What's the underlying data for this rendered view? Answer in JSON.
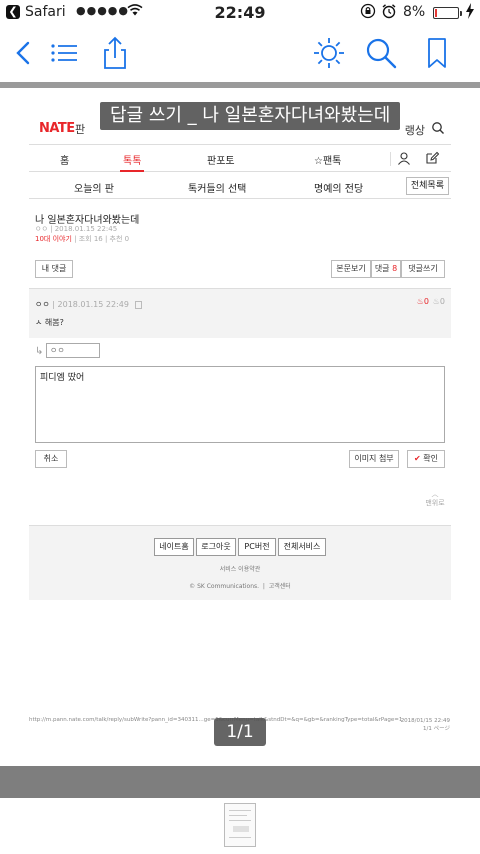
{
  "status_bar": {
    "back_app": "Safari",
    "signal": "●●●●●",
    "time": "22:49",
    "battery_pct": "8%",
    "battery_level": 0.08
  },
  "toolbar": {
    "back_icon": "chevron-left-icon",
    "list_icon": "list-icon",
    "share_icon": "share-icon",
    "brightness_icon": "brightness-icon",
    "search_icon": "search-icon",
    "bookmark_icon": "bookmark-icon",
    "accent": "#1a73e8"
  },
  "pdf_title": "답글 쓰기 _ 나 일본혼자다녀와봤는데",
  "site": {
    "logo": "NATE",
    "logo_suffix": "판",
    "header_right": "랭상"
  },
  "nav": {
    "tabs": [
      "홈",
      "톡톡",
      "판포토",
      "☆팬톡"
    ],
    "sub_tabs": [
      "오늘의 판",
      "톡커들의 선택",
      "명예의 전당"
    ],
    "list_button": "전체목록"
  },
  "post": {
    "title": "나 일본혼자다녀와봤는데",
    "author": "ㅇㅇ",
    "date": "2018.01.15 22:45",
    "category": "10대 이야기",
    "views": "조회 16",
    "recommends": "추천 0"
  },
  "actions": {
    "my_comments": "내 댓글",
    "view_original": "본문보기",
    "comments_label": "댓글",
    "comments_count": "8",
    "write_comment": "댓글쓰기"
  },
  "comment": {
    "author": "ㅇㅇ",
    "date": "2018.01.15 22:49",
    "text": "ㅅ 해봄?",
    "likes": "0",
    "dislikes": "0"
  },
  "reply": {
    "nickname_placeholder": "ㅇㅇ",
    "text": "피디엠 땄어",
    "cancel": "취소",
    "attach_image": "이미지 첨부",
    "confirm": "확인"
  },
  "to_top": "맨위로",
  "footer": {
    "buttons": [
      "네이트홈",
      "로그아웃",
      "PC버전",
      "전체서비스"
    ],
    "terms": "서비스 이용약관",
    "copyright": "© SK Communications.",
    "support": "고객센터"
  },
  "print_meta": {
    "url": "http://m.pann.nate.com/talk/reply/subWrite?pann_id=340311...ge=1&currMenu=talk&stndDt=&q=&gb=&rankingType=total&rPage=1",
    "date": "2018/01/15 22:49",
    "page_of": "1/1 ページ"
  },
  "page_indicator": "1/1"
}
